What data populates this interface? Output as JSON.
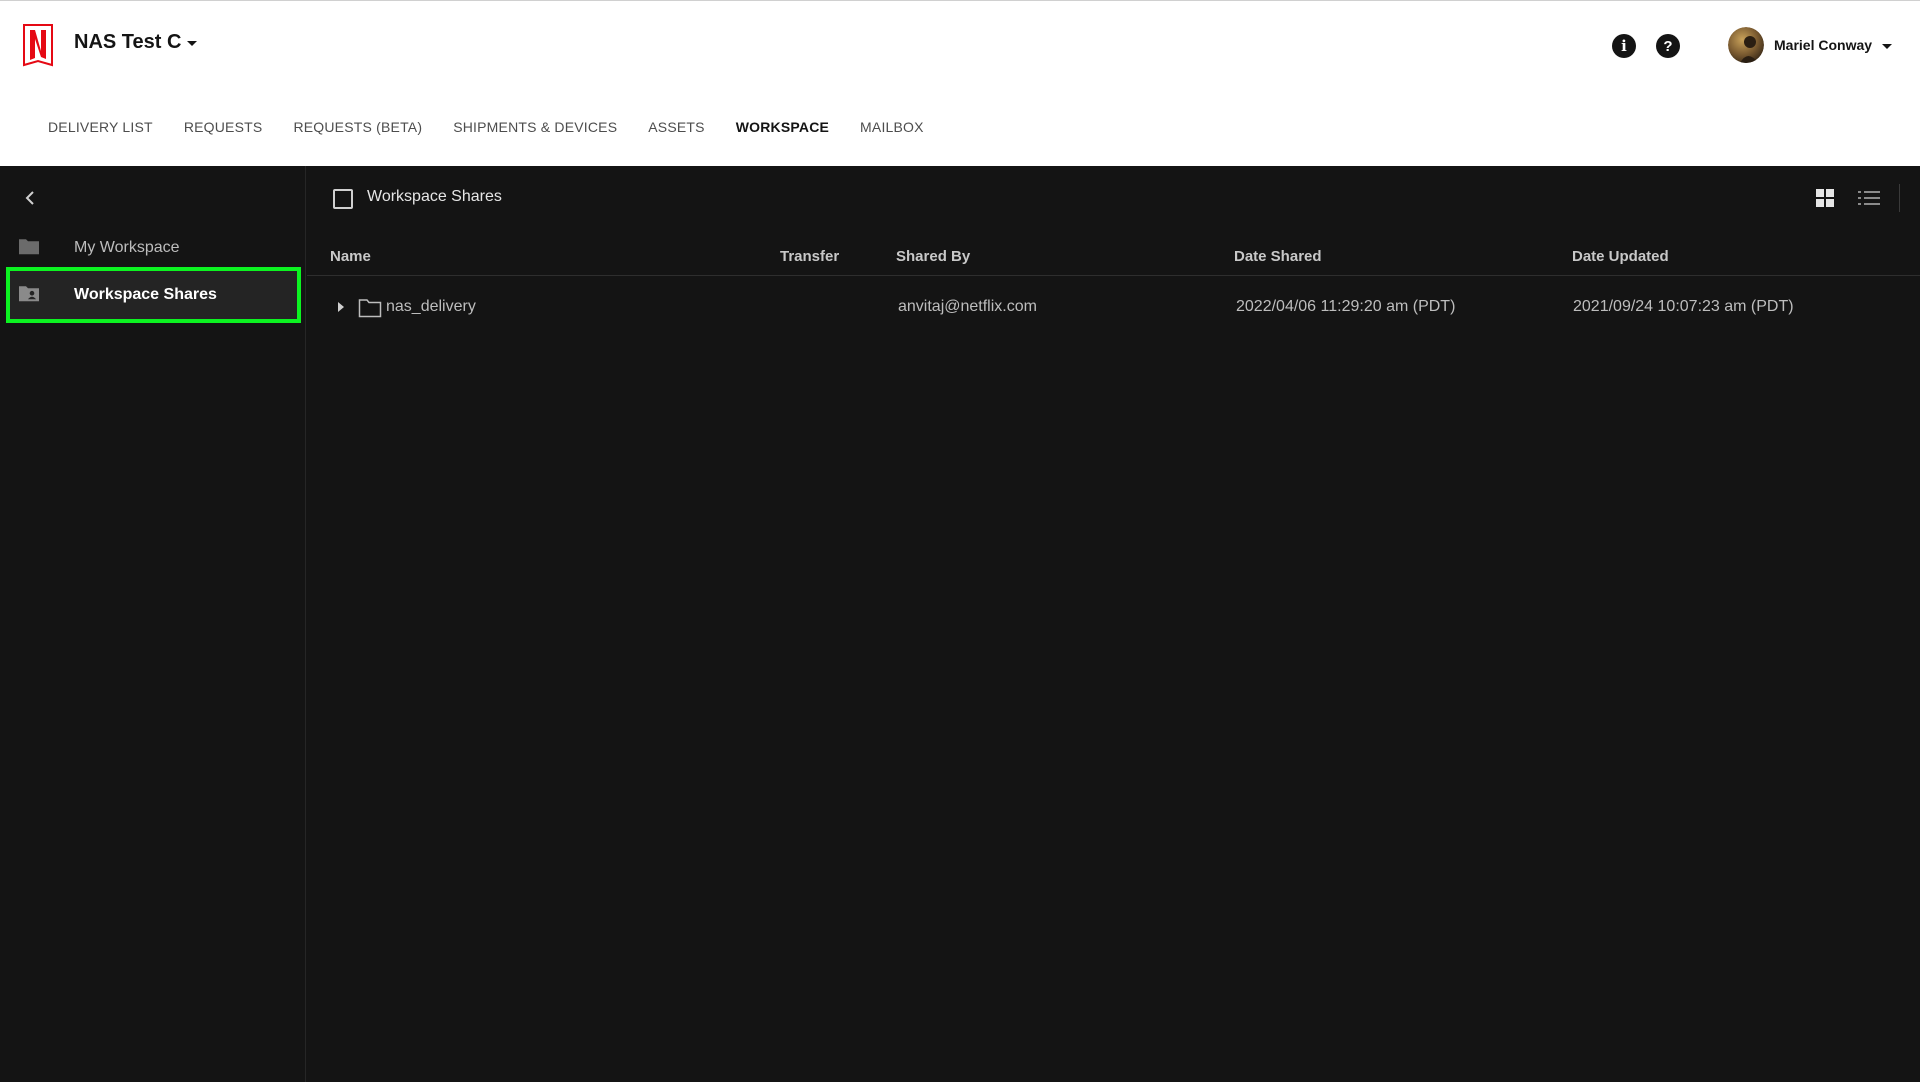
{
  "header": {
    "app_title": "NAS Test C",
    "info_icon": "info-icon",
    "help_icon": "help-icon",
    "user_name": "Mariel Conway"
  },
  "nav": {
    "items": [
      {
        "label": "DELIVERY LIST",
        "active": false
      },
      {
        "label": "REQUESTS",
        "active": false
      },
      {
        "label": "REQUESTS (BETA)",
        "active": false
      },
      {
        "label": "SHIPMENTS & DEVICES",
        "active": false
      },
      {
        "label": "ASSETS",
        "active": false
      },
      {
        "label": "WORKSPACE",
        "active": true
      },
      {
        "label": "MAILBOX",
        "active": false
      }
    ]
  },
  "sidebar": {
    "items": [
      {
        "label": "My Workspace",
        "icon": "folder-icon",
        "selected": false
      },
      {
        "label": "Workspace Shares",
        "icon": "shared-folder-icon",
        "selected": true
      }
    ]
  },
  "main": {
    "title": "Workspace Shares",
    "columns": {
      "name": "Name",
      "transfer": "Transfer",
      "shared_by": "Shared By",
      "date_shared": "Date Shared",
      "date_updated": "Date Updated"
    },
    "rows": [
      {
        "name": "nas_delivery",
        "transfer": "",
        "shared_by": "anvitaj@netflix.com",
        "date_shared": "2022/04/06 11:29:20 am (PDT)",
        "date_updated": "2021/09/24 10:07:23 am (PDT)"
      }
    ]
  },
  "colors": {
    "accent_brand": "#e50914",
    "selection_outline": "#0cf321",
    "background_dark": "#141414",
    "header_bg": "#ffffff"
  }
}
